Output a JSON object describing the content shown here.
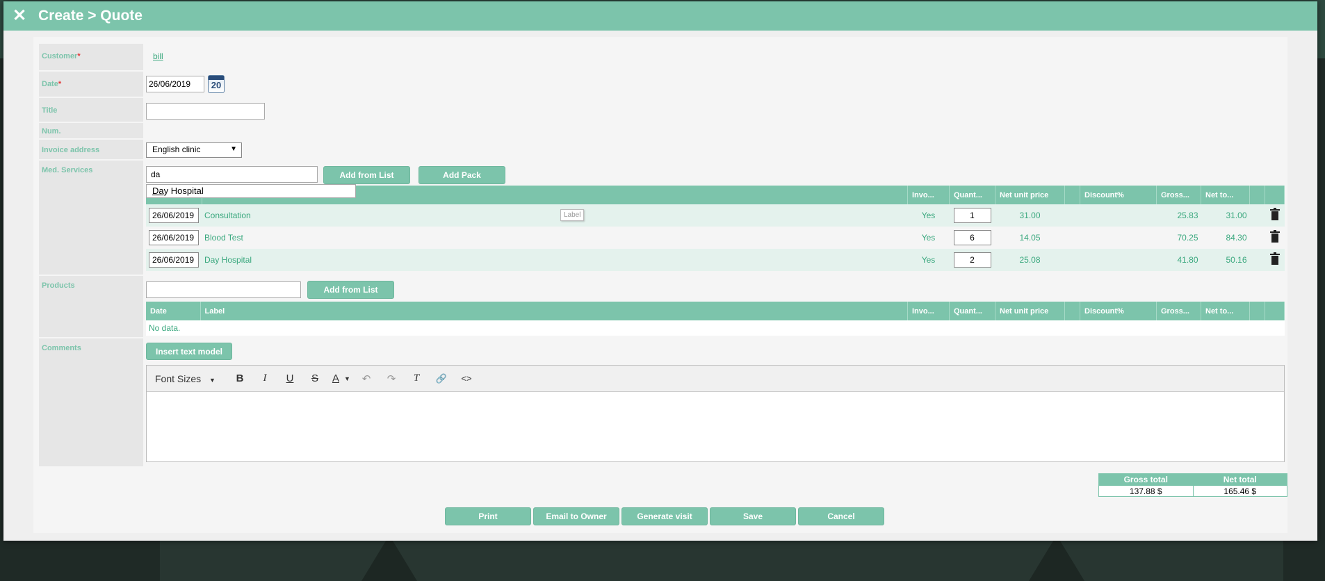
{
  "window": {
    "title": "Create > Quote",
    "close_icon": "close-icon"
  },
  "form": {
    "customer": {
      "label": "Customer",
      "required_mark": "*",
      "value": "bill"
    },
    "date": {
      "label": "Date",
      "required_mark": "*",
      "value": "26/06/2019",
      "calendar_text": "20"
    },
    "title": {
      "label": "Title",
      "value": ""
    },
    "num": {
      "label": "Num."
    },
    "invoice_address": {
      "label": "Invoice address",
      "selected": "English clinic"
    },
    "med_services": {
      "label": "Med. Services",
      "search_value": "da",
      "add_from_list": "Add from List",
      "add_pack": "Add Pack",
      "autocomplete_match": "Da",
      "autocomplete_rest": "y Hospital",
      "tooltip": "Label",
      "columns": [
        "Date",
        "Label",
        "Invo...",
        "Quant...",
        "Net unit price",
        "",
        "Discount%",
        "Gross...",
        "Net to...",
        "",
        ""
      ],
      "rows": [
        {
          "date": "26/06/2019",
          "label": "Consultation",
          "invoiced": "Yes",
          "qty": "1",
          "net_unit": "31.00",
          "discount": "",
          "gross": "25.83",
          "net_total": "31.00"
        },
        {
          "date": "26/06/2019",
          "label": "Blood Test",
          "invoiced": "Yes",
          "qty": "6",
          "net_unit": "14.05",
          "discount": "",
          "gross": "70.25",
          "net_total": "84.30"
        },
        {
          "date": "26/06/2019",
          "label": "Day Hospital",
          "invoiced": "Yes",
          "qty": "2",
          "net_unit": "25.08",
          "discount": "",
          "gross": "41.80",
          "net_total": "50.16"
        }
      ]
    },
    "products": {
      "label": "Products",
      "search_value": "",
      "add_from_list": "Add from List",
      "columns": [
        "Date",
        "Label",
        "Invo...",
        "Quant...",
        "Net unit price",
        "",
        "Discount%",
        "Gross...",
        "Net to...",
        "",
        ""
      ],
      "empty_text": "No data."
    },
    "comments": {
      "label": "Comments",
      "insert_text_model": "Insert text model",
      "toolbar": {
        "font_sizes": "Font Sizes",
        "bold": "B",
        "italic": "I",
        "underline": "U",
        "strike": "S",
        "text_color": "A",
        "undo": "↶",
        "redo": "↷",
        "clear_format": "T",
        "link": "🔗",
        "code": "<>"
      }
    }
  },
  "totals": {
    "gross_label": "Gross total",
    "net_label": "Net total",
    "gross_value": "137.88 $",
    "net_value": "165.46 $"
  },
  "footer": {
    "print": "Print",
    "email_owner": "Email to Owner",
    "generate_visit": "Generate visit",
    "save": "Save",
    "cancel": "Cancel"
  },
  "colors": {
    "accent": "#7cc4ab",
    "text_green": "#3aa87e",
    "required": "#e23a3a"
  }
}
